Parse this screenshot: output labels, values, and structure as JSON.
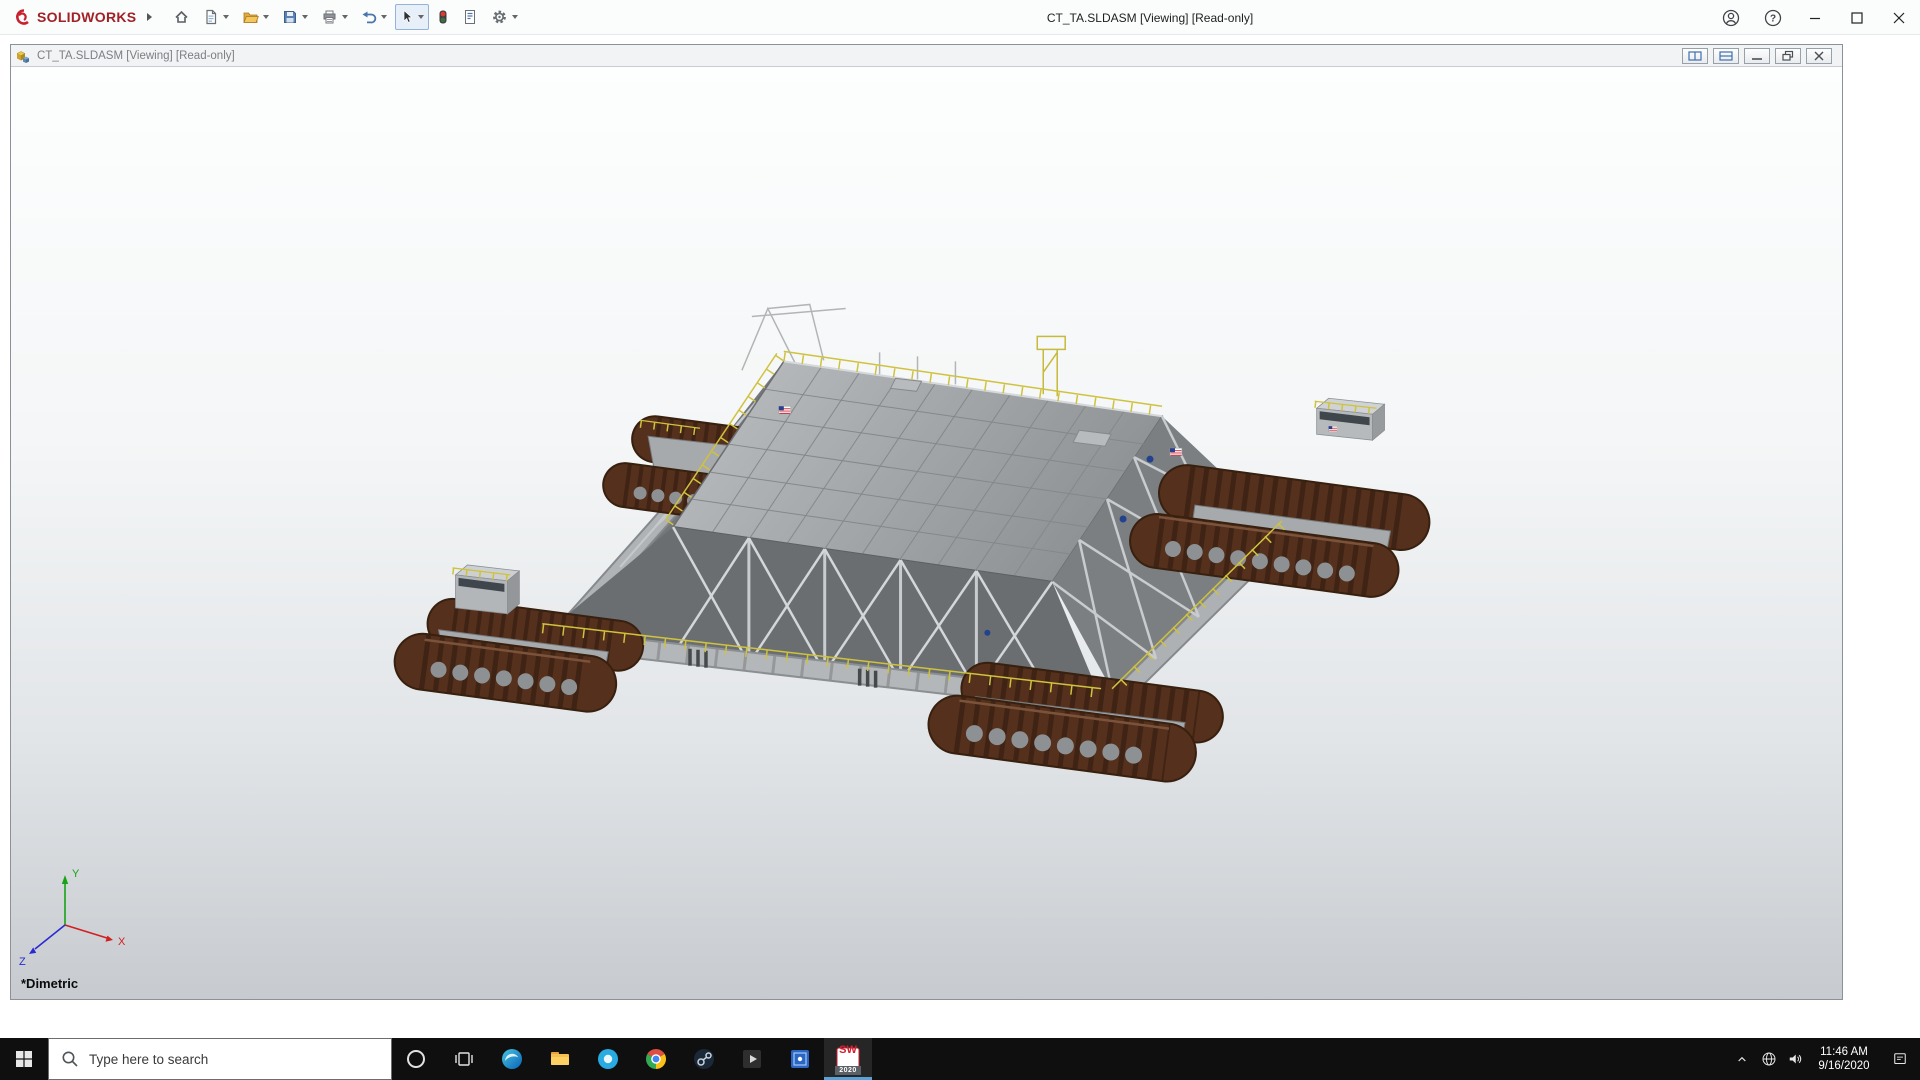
{
  "titlebar": {
    "brand": "SOLIDWORKS",
    "title": "CT_TA.SLDASM [Viewing] [Read-only]",
    "help_glyph": "?",
    "toolbar": [
      "home",
      "new",
      "open",
      "save",
      "print",
      "undo",
      "select",
      "rebuild-stoplight",
      "file-properties",
      "options"
    ],
    "controls": [
      "account",
      "help",
      "minimize",
      "maximize",
      "close"
    ]
  },
  "docbar": {
    "title": "CT_TA.SLDASM [Viewing] [Read-only]",
    "controls": [
      "tile-vertical",
      "tile-horizontal",
      "minimize",
      "restore",
      "close"
    ]
  },
  "viewport": {
    "view_label": "*Dimetric",
    "triad": {
      "x": "X",
      "y": "Y",
      "z": "Z"
    }
  },
  "taskbar": {
    "search_placeholder": "Type here to search",
    "system": [
      "start",
      "search",
      "cortana",
      "task-view"
    ],
    "pinned": [
      "edge",
      "file-explorer",
      "skype",
      "chrome",
      "steam",
      "media-player",
      "photos",
      "solidworks-2020"
    ],
    "solidworks": {
      "label": "SW",
      "year": "2020"
    },
    "tray": {
      "time": "11:46 AM",
      "date": "9/16/2020"
    }
  },
  "colors": {
    "brand_red": "#a02126",
    "deck_gray": "#a0a4a6",
    "track_brown": "#55301c",
    "rail_yellow": "#cfc23e",
    "taskbar_bg": "#0f0f0f"
  }
}
